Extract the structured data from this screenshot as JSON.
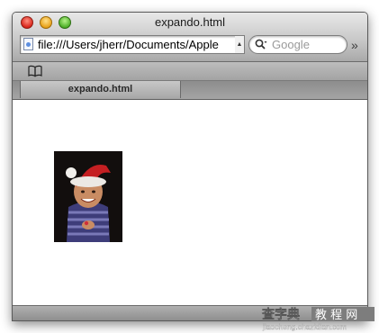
{
  "window": {
    "title": "expando.html"
  },
  "toolbar": {
    "url": "file:///Users/jherr/Documents/Apple",
    "search_placeholder": "Google"
  },
  "tabs": [
    {
      "label": "expando.html"
    }
  ],
  "content": {
    "photo": {
      "subject": "child-in-santa-hat"
    }
  },
  "icons": {
    "window_close": "close-button-icon",
    "window_minimize": "minimize-button-icon",
    "window_zoom": "zoom-button-icon",
    "page": "page-icon",
    "search": "search-icon",
    "bookmarks": "bookmarks-book-icon",
    "overflow": "chevron-double-right-icon"
  },
  "colors": {
    "close": "#d9261c",
    "minimize": "#e8a21a",
    "zoom": "#4fb02a"
  },
  "watermark": {
    "logo_text": "查字典 教 程 网",
    "domain": "jiaocheng.chazidian.com"
  }
}
